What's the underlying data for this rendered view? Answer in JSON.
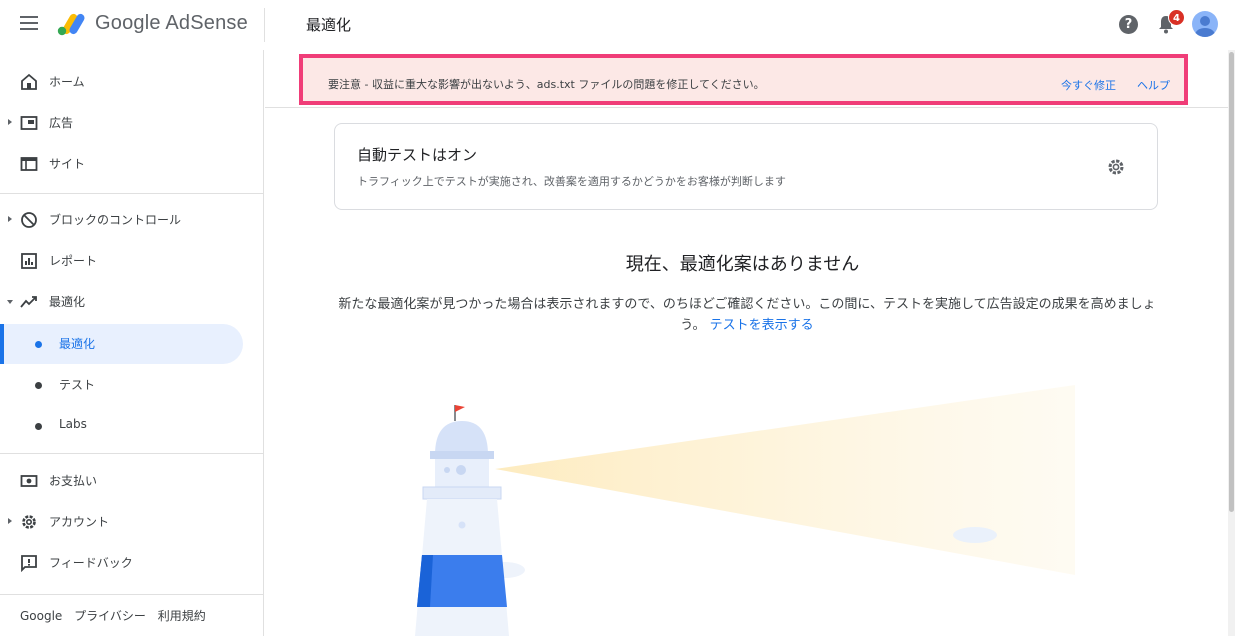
{
  "app": {
    "brand": "Google AdSense",
    "page_title": "最適化"
  },
  "header": {
    "notifications_count": "4",
    "help_glyph": "?"
  },
  "sidebar": {
    "items": [
      {
        "label": "ホーム",
        "icon": "home-icon"
      },
      {
        "label": "広告",
        "icon": "ads-icon"
      },
      {
        "label": "サイト",
        "icon": "sites-icon"
      },
      {
        "label": "ブロックのコントロール",
        "icon": "block-icon"
      },
      {
        "label": "レポート",
        "icon": "report-icon"
      },
      {
        "label": "最適化",
        "icon": "optimization-icon"
      },
      {
        "label": "お支払い",
        "icon": "payments-icon"
      },
      {
        "label": "アカウント",
        "icon": "account-gear-icon"
      },
      {
        "label": "フィードバック",
        "icon": "feedback-icon"
      }
    ],
    "sub_items": [
      {
        "label": "最適化",
        "active": true
      },
      {
        "label": "テスト",
        "active": false
      },
      {
        "label": "Labs",
        "active": false
      }
    ],
    "footer": {
      "google": "Google",
      "privacy": "プライバシー",
      "terms": "利用規約"
    }
  },
  "alert": {
    "message": "要注意 - 収益に重大な影響が出ないよう、ads.txt ファイルの問題を修正してください。",
    "fix_label": "今すぐ修正",
    "help_label": "ヘルプ",
    "highlight_color": "#f03d78",
    "background_color": "#fce8e6"
  },
  "card": {
    "title": "自動テストはオン",
    "description": "トラフィック上でテストが実施され、改善案を適用するかどうかをお客様が判断します"
  },
  "empty_state": {
    "title": "現在、最適化案はありません",
    "description": "新たな最適化案が見つかった場合は表示されますので、のちほどご確認ください。この間に、テストを実施して広告設定の成果を高めましょう。",
    "link_label": "テストを表示する"
  },
  "colors": {
    "accent": "#1a73e8",
    "active_bg": "#e8f0fe"
  }
}
